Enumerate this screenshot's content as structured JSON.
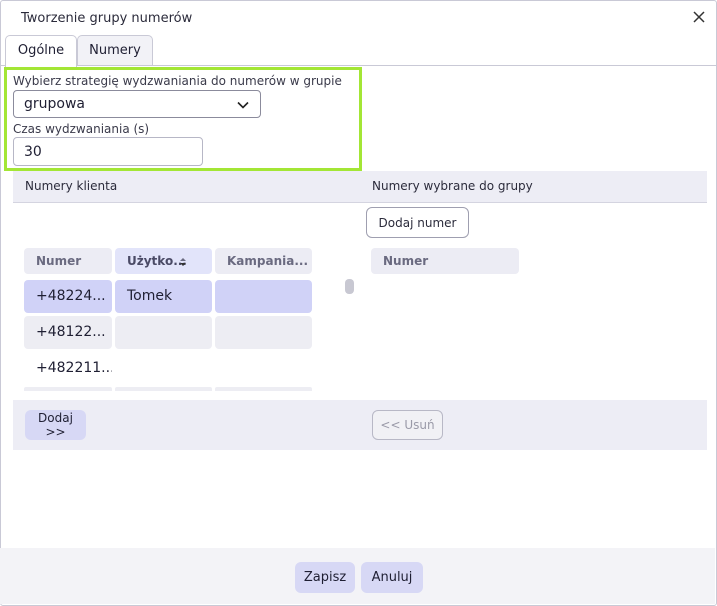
{
  "dialog": {
    "title": "Tworzenie grupy numerów",
    "close_icon": "close-icon"
  },
  "tabs": [
    {
      "label": "Ogólne",
      "active": true
    },
    {
      "label": "Numery",
      "active": false
    }
  ],
  "strategy": {
    "label": "Wybierz strategię wydzwaniania do numerów w grupie",
    "selected": "grupowa",
    "time_label": "Czas wydzwaniania (s)",
    "time_value": "30"
  },
  "client_numbers": {
    "header": "Numery klienta",
    "columns": [
      "Numer",
      "Użytko...",
      "Kampania..."
    ],
    "rows": [
      {
        "numer": "+48224...",
        "uzytkownik": "Tomek",
        "kampania": ""
      },
      {
        "numer": "+48122...",
        "uzytkownik": "",
        "kampania": ""
      },
      {
        "numer": "+482211...",
        "uzytkownik": "",
        "kampania": ""
      }
    ],
    "add_button": "Dodaj >>"
  },
  "selected_numbers": {
    "header": "Numery wybrane do grupy",
    "add_number_button": "Dodaj numer",
    "columns": [
      "Numer"
    ],
    "remove_button": "<< Usuń"
  },
  "footer": {
    "save": "Zapisz",
    "cancel": "Anuluj"
  },
  "colors": {
    "highlight": "#a3e635",
    "selected_row": "#d0d2f7",
    "primary_button": "#d7d8f5"
  }
}
